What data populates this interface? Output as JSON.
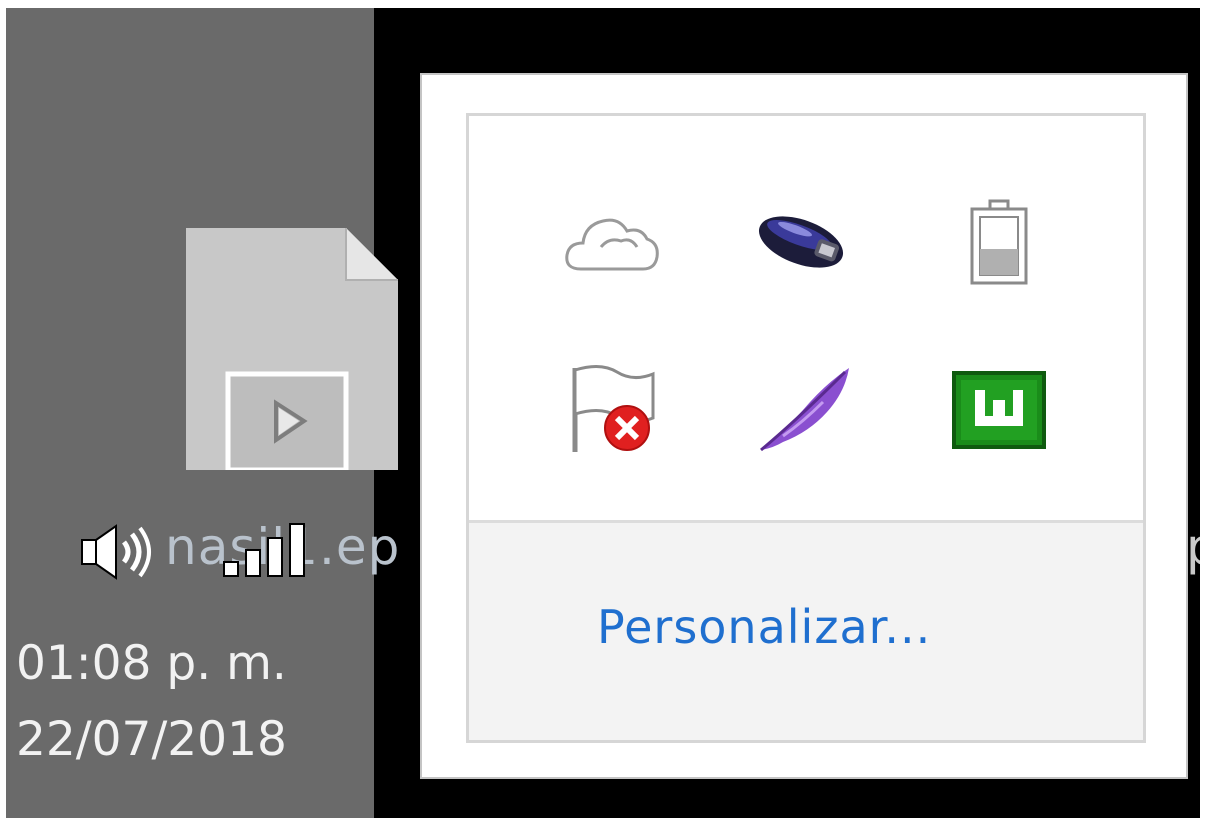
{
  "desktop": {
    "file_icon": "video-file-icon",
    "file_name_visible": "nasil1.ep",
    "file_name_right_fragment": "p"
  },
  "taskbar": {
    "sound_icon": "speaker-volume-icon",
    "network_icon": "wifi-signal-icon",
    "clock": {
      "time": "01:08 p. m.",
      "date": "22/07/2018"
    }
  },
  "tray_overflow": {
    "icons": [
      {
        "id": "onedrive",
        "icon": "cloud-icon"
      },
      {
        "id": "usb",
        "icon": "usb-drive-icon"
      },
      {
        "id": "battery",
        "icon": "battery-icon"
      },
      {
        "id": "action-center",
        "icon": "flag-error-icon"
      },
      {
        "id": "feather-app",
        "icon": "feather-icon"
      },
      {
        "id": "utorrent",
        "icon": "utorrent-icon"
      }
    ],
    "customize_label": "Personalizar..."
  },
  "colors": {
    "link": "#1f6fcf",
    "desktop_gray": "#6a6a6a",
    "popup_border": "#c4c4c4",
    "customize_bg": "#f3f3f3",
    "utorrent_green": "#1a8c1a",
    "feather_purple": "#8a4fd0",
    "error_red": "#e02020"
  }
}
